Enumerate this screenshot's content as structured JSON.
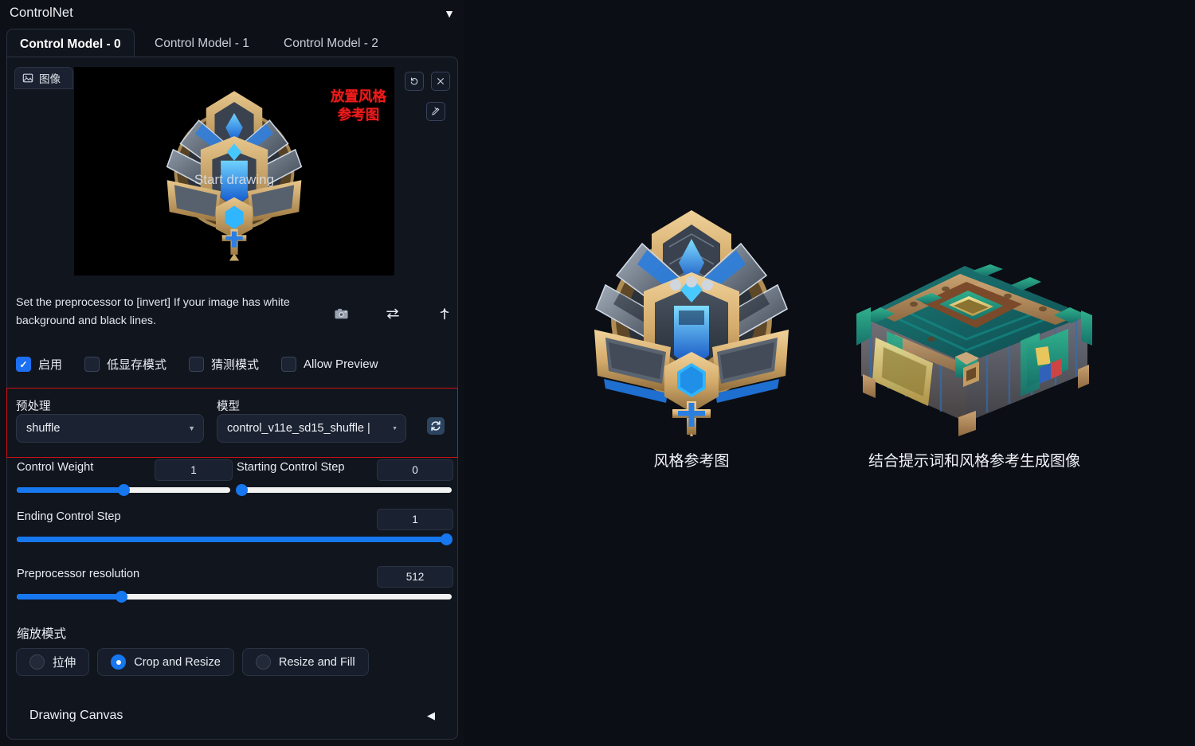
{
  "panel": {
    "title": "ControlNet",
    "collapse_icon": "chevron-down-icon",
    "tabs": [
      {
        "label": "Control Model - 0",
        "active": true
      },
      {
        "label": "Control Model - 1",
        "active": false
      },
      {
        "label": "Control Model - 2",
        "active": false
      }
    ],
    "image_tab": {
      "label": "图像",
      "icon": "image-icon"
    },
    "preview": {
      "annotation": "放置风格\n参考图",
      "annotation_line1": "放置风格",
      "annotation_line2": "参考图",
      "annotation_color": "#f01c1c",
      "start_drawing_label": "Start drawing",
      "buttons": [
        {
          "name": "undo-icon",
          "glyph": "↺"
        },
        {
          "name": "close-icon",
          "glyph": "✕"
        },
        {
          "name": "edit-pen-icon",
          "glyph": "✎"
        }
      ]
    },
    "hint_text": "Set the preprocessor to [invert] If your image has white background and black lines.",
    "action_icons": [
      {
        "name": "camera-icon",
        "glyph": "📷"
      },
      {
        "name": "swap-arrows-icon",
        "glyph": "⇄"
      },
      {
        "name": "upload-arrow-icon",
        "glyph": "⇧"
      }
    ],
    "checkboxes": [
      {
        "label": "启用",
        "checked": true
      },
      {
        "label": "低显存模式",
        "checked": false
      },
      {
        "label": "猜测模式",
        "checked": false
      },
      {
        "label": "Allow Preview",
        "checked": false
      }
    ],
    "preprocessor": {
      "label": "预处理",
      "value": "shuffle",
      "icon": "chevron-down-icon"
    },
    "model": {
      "label": "模型",
      "value": "control_v11e_sd15_shuffle |",
      "icon": "chevron-down-icon"
    },
    "refresh_icon": "refresh-icon",
    "highlight_color": "#cc1111",
    "sliders": [
      {
        "name": "control-weight",
        "label": "Control Weight",
        "value": "1",
        "percent": 50
      },
      {
        "name": "starting-control-step",
        "label": "Starting Control Step",
        "value": "0",
        "percent": 0
      },
      {
        "name": "ending-control-step",
        "label": "Ending Control Step",
        "value": "1",
        "percent": 100
      },
      {
        "name": "preprocessor-resolution",
        "label": "Preprocessor resolution",
        "value": "512",
        "percent": 24
      }
    ],
    "resize_mode": {
      "label": "缩放模式",
      "options": [
        {
          "label": "拉伸",
          "selected": false
        },
        {
          "label": "Crop and Resize",
          "selected": true
        },
        {
          "label": "Resize and Fill",
          "selected": false
        }
      ]
    },
    "drawing_canvas": {
      "label": "Drawing Canvas",
      "collapse_icon": "chevron-left-icon"
    }
  },
  "showcase": [
    {
      "caption": "风格参考图",
      "art": "knight-helmet-emblem"
    },
    {
      "caption": "结合提示词和风格参考生成图像",
      "art": "treasure-chest"
    }
  ]
}
